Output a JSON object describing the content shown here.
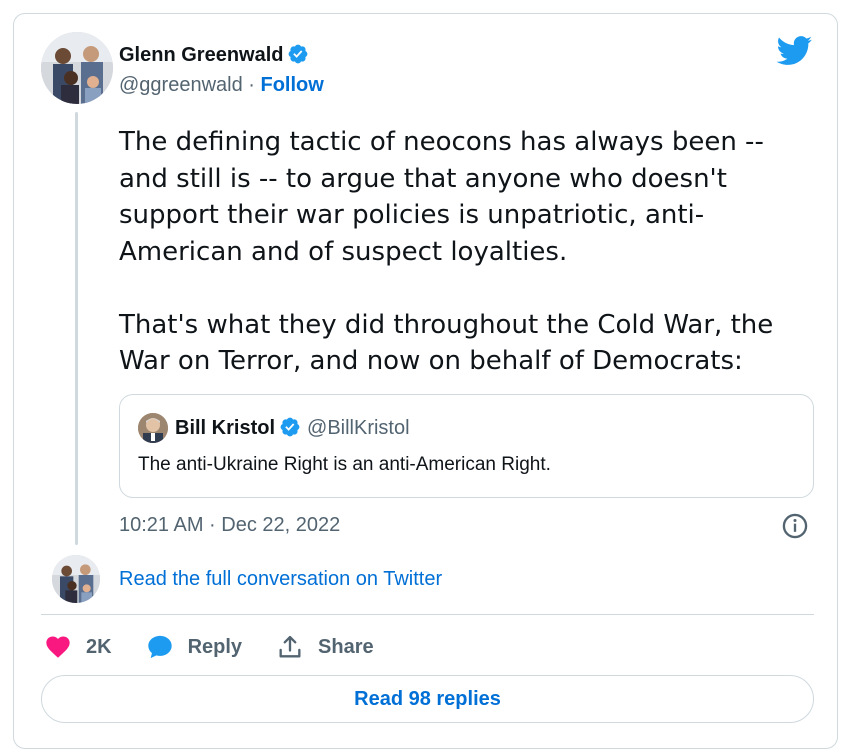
{
  "author": {
    "name": "Glenn Greenwald",
    "handle": "@ggreenwald",
    "separator": " · ",
    "follow_label": "Follow",
    "avatar_icon": "group-photo-avatar"
  },
  "tweet": {
    "text": "The defining tactic of neocons has always been --\nand still is -- to argue that anyone who doesn't\nsupport their war policies is unpatriotic, anti-\nAmerican and of suspect loyalties.\n\nThat's what they did throughout the Cold War, the\nWar on Terror, and now on behalf of Democrats:",
    "timestamp": "10:21 AM · Dec 22, 2022"
  },
  "quote": {
    "name": "Bill Kristol",
    "handle": "@BillKristol",
    "text": "The anti-Ukraine Right is an anti-American Right."
  },
  "conversation_link": "Read the full conversation on Twitter",
  "actions": {
    "likes": "2K",
    "reply": "Reply",
    "share": "Share"
  },
  "read_replies": "Read 98 replies",
  "colors": {
    "link": "#006fd6",
    "verified": "#1d9bf0",
    "heart": "#f91880",
    "muted": "#536471",
    "border": "#cfd9de",
    "twitter_blue": "#1d9bf0"
  }
}
